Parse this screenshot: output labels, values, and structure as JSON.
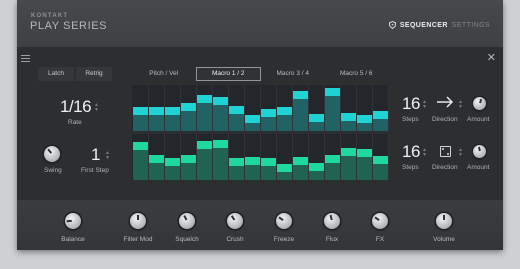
{
  "header": {
    "brand_top": "KONTAKT",
    "brand_main": "PLAY SERIES",
    "nav_sequencer": "SEQUENCER",
    "nav_settings": "SETTINGS"
  },
  "sequencer": {
    "buttons": {
      "latch": "Latch",
      "retrig": "Retrig"
    },
    "rate": {
      "value": "1/16",
      "label": "Rate"
    },
    "swing": {
      "label": "Swing",
      "level": 0.35
    },
    "first_step": {
      "value": "1",
      "label": "First Step"
    },
    "tabs": [
      "Pitch / Vel",
      "Macro 1 / 2",
      "Macro 3 / 4",
      "Macro 5 / 6"
    ],
    "selected_tab": 1,
    "lane1": {
      "steps_value": "16",
      "steps_label": "Steps",
      "direction_label": "Direction",
      "amount_label": "Amount",
      "amount_level": 0.55,
      "color": "#1fd3d4",
      "values": [
        0.52,
        0.52,
        0.53,
        0.6,
        0.78,
        0.75,
        0.55,
        0.35,
        0.48,
        0.52,
        0.88,
        0.38,
        0.93,
        0.4,
        0.35,
        0.44
      ]
    },
    "lane2": {
      "steps_value": "16",
      "steps_label": "Steps",
      "direction_label": "Direction",
      "amount_label": "Amount",
      "amount_level": 0.45,
      "color": "#1fd89d",
      "values": [
        0.82,
        0.55,
        0.48,
        0.55,
        0.85,
        0.88,
        0.48,
        0.5,
        0.48,
        0.35,
        0.5,
        0.38,
        0.55,
        0.7,
        0.68,
        0.52
      ]
    }
  },
  "footer": {
    "knobs": [
      {
        "label": "Balance",
        "level": 0.15
      },
      {
        "label": "Filter Mod",
        "level": 0.5
      },
      {
        "label": "Squelch",
        "level": 0.4
      },
      {
        "label": "Crush",
        "level": 0.38
      },
      {
        "label": "Freeze",
        "level": 0.3
      },
      {
        "label": "Flux",
        "level": 0.45
      },
      {
        "label": "FX",
        "level": 0.3
      },
      {
        "label": "Volume",
        "level": 0.5
      }
    ]
  },
  "colors": {
    "accent_cyan": "#1fd3d4",
    "accent_green": "#1fd89d",
    "panel": "#2c2e30",
    "header": "#3d4043"
  }
}
